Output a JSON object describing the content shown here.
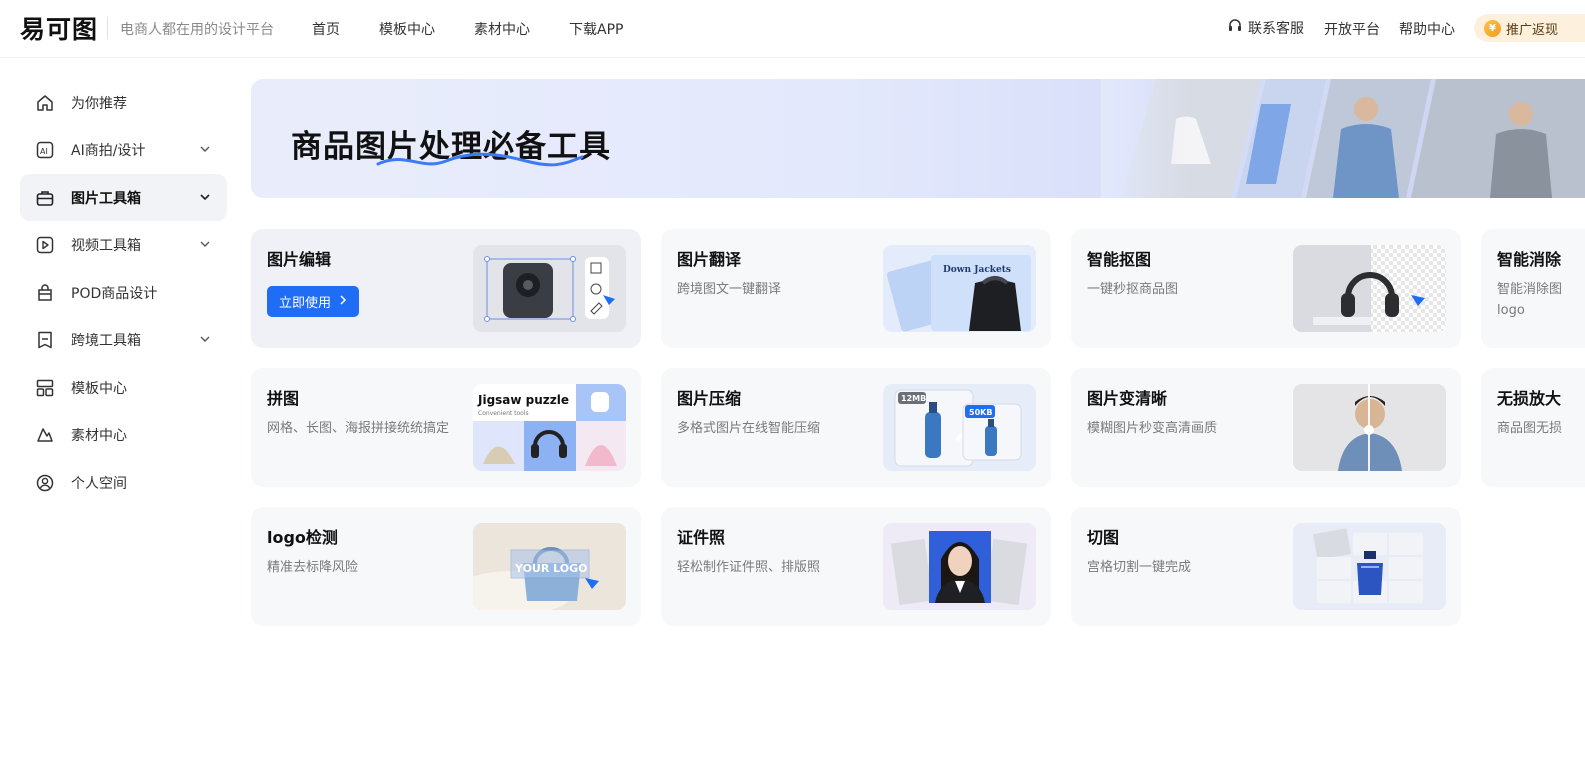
{
  "header": {
    "logo": "易可图",
    "slogan": "电商人都在用的设计平台",
    "nav": [
      "首页",
      "模板中心",
      "素材中心",
      "下载APP"
    ],
    "support": "联系客服",
    "open_platform": "开放平台",
    "help_center": "帮助中心",
    "promo": "推广返现"
  },
  "sidebar": {
    "items": [
      {
        "label": "为你推荐",
        "icon": "home-icon"
      },
      {
        "label": "AI商拍/设计",
        "icon": "ai-icon"
      },
      {
        "label": "图片工具箱",
        "icon": "toolbox-icon"
      },
      {
        "label": "视频工具箱",
        "icon": "video-icon"
      },
      {
        "label": "POD商品设计",
        "icon": "bag-icon"
      },
      {
        "label": "跨境工具箱",
        "icon": "crossborder-icon"
      },
      {
        "label": "模板中心",
        "icon": "template-icon"
      },
      {
        "label": "素材中心",
        "icon": "shapes-icon"
      },
      {
        "label": "个人空间",
        "icon": "user-icon"
      }
    ]
  },
  "banner": {
    "title": "商品图片处理必备工具"
  },
  "cards": [
    {
      "title": "图片编辑",
      "button": "立即使用"
    },
    {
      "title": "图片翻译",
      "desc": "跨境图文一键翻译",
      "thumb_text": "Down Jackets"
    },
    {
      "title": "智能抠图",
      "desc": "一键秒抠商品图"
    },
    {
      "title": "智能消除",
      "desc": "智能消除图 logo"
    },
    {
      "title": "拼图",
      "desc": "网格、长图、海报拼接统统搞定",
      "thumb_title": "Jigsaw puzzle",
      "thumb_sub": "Convenient tools"
    },
    {
      "title": "图片压缩",
      "desc": "多格式图片在线智能压缩",
      "size_before": "12MB",
      "size_after": "50KB"
    },
    {
      "title": "图片变清晰",
      "desc": "模糊图片秒变高清画质"
    },
    {
      "title": "无损放大",
      "desc": "商品图无损"
    },
    {
      "title": "logo检测",
      "desc": "精准去标降风险",
      "thumb_text": "YOUR LOGO"
    },
    {
      "title": "证件照",
      "desc": "轻松制作证件照、排版照"
    },
    {
      "title": "切图",
      "desc": "宫格切割一键完成"
    }
  ]
}
